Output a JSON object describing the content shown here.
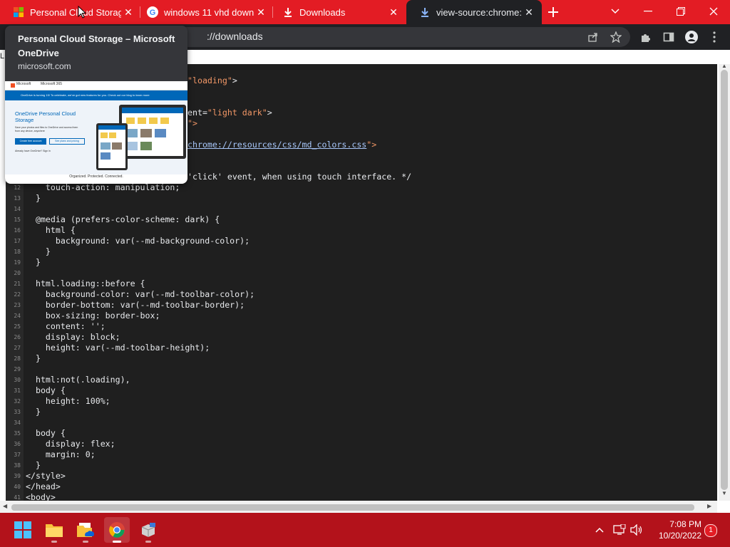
{
  "tabs": [
    {
      "title": "Personal Cloud Storage – Microsoft OneDrive",
      "favicon": "microsoft-logo-icon",
      "close": "✕"
    },
    {
      "title": "windows 11 vhd download",
      "favicon": "google-g-icon",
      "close": "✕"
    },
    {
      "title": "Downloads",
      "favicon": "download-icon",
      "close": "✕"
    },
    {
      "title": "view-source:chrome://downloads",
      "favicon": "download-icon",
      "close": "✕"
    }
  ],
  "toolbar": {
    "url": "://downloads"
  },
  "left_fragment": "L",
  "hovercard": {
    "title": "Personal Cloud Storage – Microsoft OneDrive",
    "domain": "microsoft.com",
    "preview": {
      "nav_items": [
        "Microsoft",
        "Microsoft 365"
      ],
      "banner": "OneDrive is turning 15! To celebrate, we've got new features for you. Check out our blog to learn more",
      "heading": "OneDrive Personal Cloud Storage",
      "subtext": "Save your photos and files to OneDrive and access them from any device, anywhere",
      "button_primary": "Create free account",
      "button_secondary": "See plans and pricing",
      "signin": "Already have OneDrive? Sign in",
      "footer": "Organized. Protected. Connected."
    }
  },
  "code": {
    "lines": [
      {
        "n": "",
        "segs": [
          {
            "t": "\"loading\"",
            "c": "str"
          },
          {
            "t": ">",
            "c": ""
          }
        ]
      },
      {
        "n": "",
        "segs": []
      },
      {
        "n": "",
        "segs": []
      },
      {
        "n": "",
        "segs": [
          {
            "t": "ent=",
            "c": ""
          },
          {
            "t": "\"light dark\"",
            "c": "str"
          },
          {
            "t": ">",
            "c": ""
          }
        ]
      },
      {
        "n": "",
        "segs": [
          {
            "t": "\">",
            "c": "str"
          }
        ]
      },
      {
        "n": "",
        "segs": []
      },
      {
        "n": "",
        "segs": [
          {
            "t": "chrome://resources/css/md_colors.css",
            "c": "lnk"
          },
          {
            "t": "\">",
            "c": "str"
          }
        ]
      },
      {
        "n": "",
        "segs": []
      },
      {
        "n": "",
        "segs": []
      },
      {
        "n": "",
        "segs": [
          {
            "t": "'click' event, when using touch interface. */",
            "c": ""
          }
        ]
      },
      {
        "n": "12",
        "segs": [
          {
            "t": "    touch-action: manipulation;",
            "c": ""
          }
        ]
      },
      {
        "n": "13",
        "segs": [
          {
            "t": "  }",
            "c": ""
          }
        ]
      },
      {
        "n": "14",
        "segs": []
      },
      {
        "n": "15",
        "segs": [
          {
            "t": "  @media (prefers-color-scheme: dark) {",
            "c": ""
          }
        ]
      },
      {
        "n": "16",
        "segs": [
          {
            "t": "    html {",
            "c": ""
          }
        ]
      },
      {
        "n": "17",
        "segs": [
          {
            "t": "      background: var(--md-background-color);",
            "c": ""
          }
        ]
      },
      {
        "n": "18",
        "segs": [
          {
            "t": "    }",
            "c": ""
          }
        ]
      },
      {
        "n": "19",
        "segs": [
          {
            "t": "  }",
            "c": ""
          }
        ]
      },
      {
        "n": "20",
        "segs": []
      },
      {
        "n": "21",
        "segs": [
          {
            "t": "  html.loading::before {",
            "c": ""
          }
        ]
      },
      {
        "n": "22",
        "segs": [
          {
            "t": "    background-color: var(--md-toolbar-color);",
            "c": ""
          }
        ]
      },
      {
        "n": "23",
        "segs": [
          {
            "t": "    border-bottom: var(--md-toolbar-border);",
            "c": ""
          }
        ]
      },
      {
        "n": "24",
        "segs": [
          {
            "t": "    box-sizing: border-box;",
            "c": ""
          }
        ]
      },
      {
        "n": "25",
        "segs": [
          {
            "t": "    content: '';",
            "c": ""
          }
        ]
      },
      {
        "n": "26",
        "segs": [
          {
            "t": "    display: block;",
            "c": ""
          }
        ]
      },
      {
        "n": "27",
        "segs": [
          {
            "t": "    height: var(--md-toolbar-height);",
            "c": ""
          }
        ]
      },
      {
        "n": "28",
        "segs": [
          {
            "t": "  }",
            "c": ""
          }
        ]
      },
      {
        "n": "29",
        "segs": []
      },
      {
        "n": "30",
        "segs": [
          {
            "t": "  html:not(.loading),",
            "c": ""
          }
        ]
      },
      {
        "n": "31",
        "segs": [
          {
            "t": "  body {",
            "c": ""
          }
        ]
      },
      {
        "n": "32",
        "segs": [
          {
            "t": "    height: 100%;",
            "c": ""
          }
        ]
      },
      {
        "n": "33",
        "segs": [
          {
            "t": "  }",
            "c": ""
          }
        ]
      },
      {
        "n": "34",
        "segs": []
      },
      {
        "n": "35",
        "segs": [
          {
            "t": "  body {",
            "c": ""
          }
        ]
      },
      {
        "n": "36",
        "segs": [
          {
            "t": "    display: flex;",
            "c": ""
          }
        ]
      },
      {
        "n": "37",
        "segs": [
          {
            "t": "    margin: 0;",
            "c": ""
          }
        ]
      },
      {
        "n": "38",
        "segs": [
          {
            "t": "  }",
            "c": ""
          }
        ]
      },
      {
        "n": "39",
        "segs": [
          {
            "t": "</style>",
            "c": ""
          }
        ]
      },
      {
        "n": "40",
        "segs": [
          {
            "t": "</head>",
            "c": ""
          }
        ]
      },
      {
        "n": "41",
        "segs": [
          {
            "t": "<body>",
            "c": ""
          }
        ]
      }
    ]
  },
  "taskbar": {
    "apps": [
      "windows-start-icon",
      "file-explorer-icon",
      "onedrive-folder-icon",
      "chrome-icon",
      "installer-box-icon"
    ],
    "time": "7:08 PM",
    "date": "10/20/2022",
    "notification_count": "1"
  },
  "colors": {
    "tabstrip": "#e31c24",
    "toolbar": "#202124",
    "editor_bg": "#1f1f1f",
    "string": "#f29766",
    "link": "#a8c7fa",
    "taskbar": "#b3121b"
  }
}
